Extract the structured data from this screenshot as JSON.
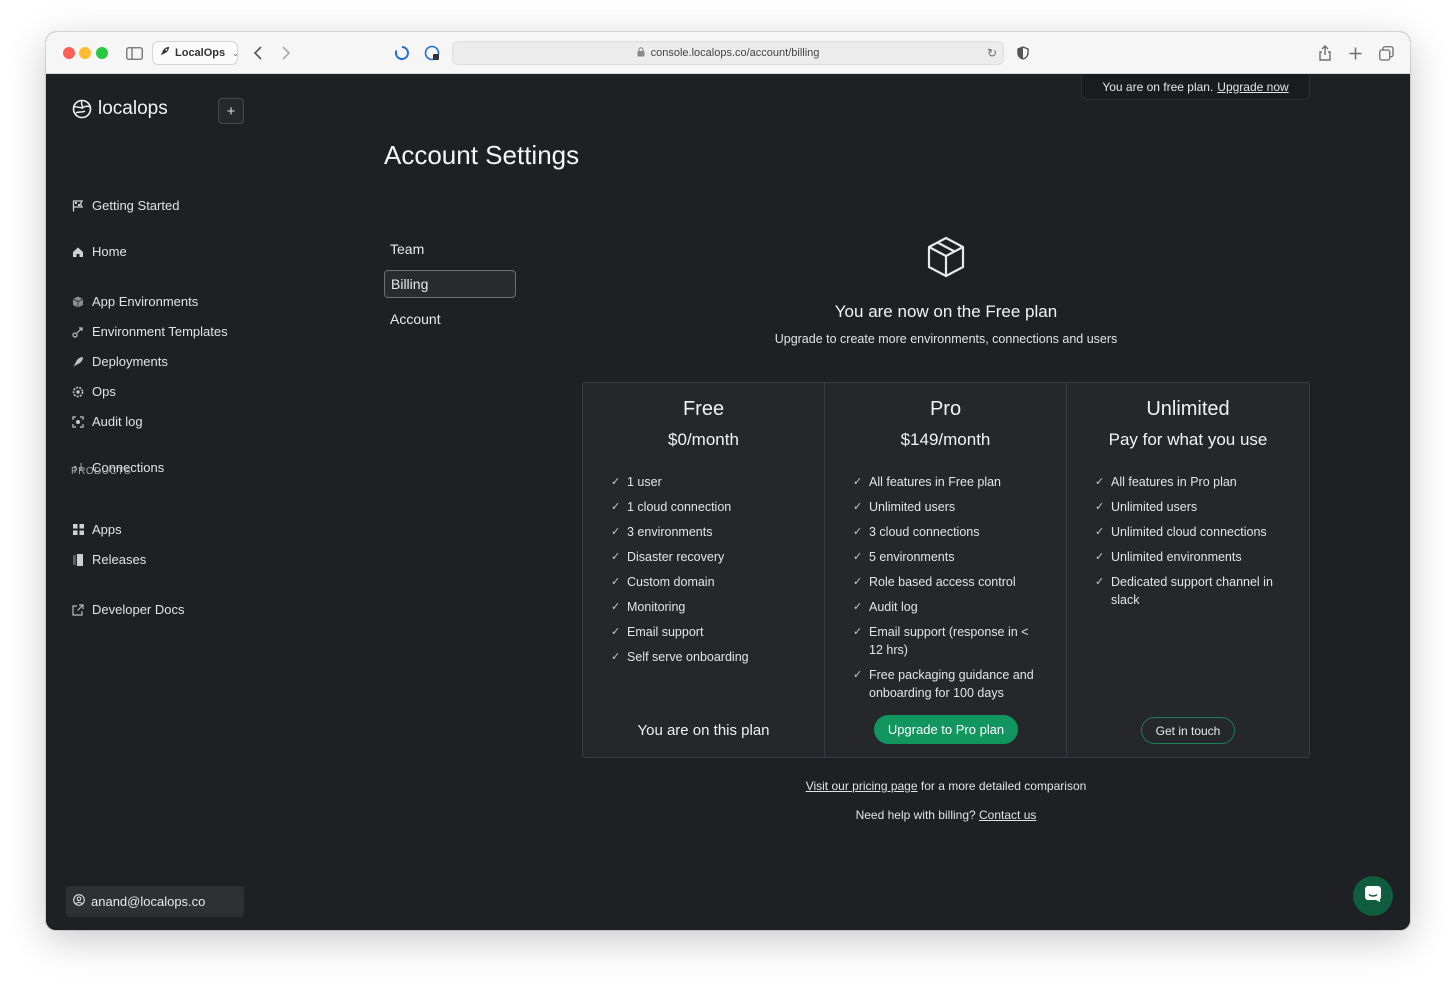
{
  "browser": {
    "tab_label": "LocalOps",
    "url": "console.localops.co/account/billing"
  },
  "app": {
    "logo_text": "localops",
    "plus_label": "+",
    "banner_text": "You are on free plan.",
    "banner_link": "Upgrade now",
    "user_email": "anand@localops.co"
  },
  "sidebar": {
    "items": [
      {
        "label": "Getting Started",
        "icon": "flag-icon"
      },
      {
        "label": "Home",
        "icon": "home-icon"
      },
      {
        "label": "App Environments",
        "icon": "cube-icon"
      },
      {
        "label": "Environment Templates",
        "icon": "template-icon"
      },
      {
        "label": "Deployments",
        "icon": "rocket-icon"
      },
      {
        "label": "Ops",
        "icon": "gear-icon"
      },
      {
        "label": "Audit log",
        "icon": "audit-icon"
      },
      {
        "label": "Connections",
        "icon": "connections-icon"
      }
    ],
    "products_heading": "PRODUCTS",
    "products": [
      {
        "label": "Apps",
        "icon": "grid-icon"
      },
      {
        "label": "Releases",
        "icon": "releases-icon"
      }
    ],
    "docs": {
      "label": "Developer Docs",
      "icon": "external-link-icon"
    }
  },
  "main": {
    "title": "Account Settings",
    "tabs": [
      {
        "label": "Team",
        "active": false
      },
      {
        "label": "Billing",
        "active": true
      },
      {
        "label": "Account",
        "active": false
      }
    ],
    "current_plan_heading": "You are now on the Free plan",
    "current_plan_sub": "Upgrade to create more environments, connections and users",
    "plans": [
      {
        "name": "Free",
        "price": "$0/month",
        "features": [
          "1 user",
          "1 cloud connection",
          "3 environments",
          "Disaster recovery",
          "Custom domain",
          "Monitoring",
          "Email support",
          "Self serve onboarding"
        ],
        "footer": "You are on this plan"
      },
      {
        "name": "Pro",
        "price": "$149/month",
        "features": [
          "All features in Free plan",
          "Unlimited users",
          "3 cloud connections",
          "5 environments",
          "Role based access control",
          "Audit log",
          "Email support (response in < 12 hrs)",
          "Free packaging guidance and onboarding for 100 days"
        ],
        "button": "Upgrade to Pro plan"
      },
      {
        "name": "Unlimited",
        "price": "Pay for what you use",
        "features": [
          "All features in Pro plan",
          "Unlimited users",
          "Unlimited cloud connections",
          "Unlimited environments",
          "Dedicated support channel in slack"
        ],
        "button": "Get in touch"
      }
    ],
    "pricing_link": "Visit our pricing page",
    "pricing_rest": "for a more detailed comparison",
    "help_text": "Need help with billing?",
    "contact_link": "Contact us"
  },
  "colors": {
    "background": "#1f2023",
    "accent_green": "#129660"
  }
}
